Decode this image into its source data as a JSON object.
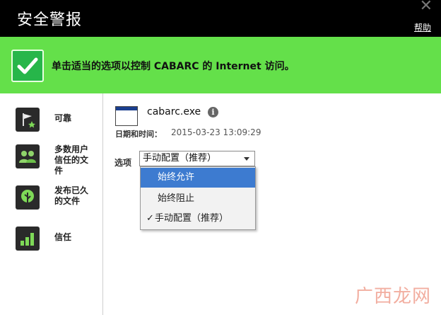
{
  "window": {
    "title": "安全警报",
    "help_label": "帮助",
    "close_glyph": "✕"
  },
  "banner": {
    "message": "单击适当的选项以控制 CABARC 的 Internet 访问。",
    "accent": "#64e04a"
  },
  "sidebar": {
    "items": [
      {
        "label": "可靠",
        "icon": "flag-star-icon"
      },
      {
        "label": "多数用户信任的文件",
        "icon": "users-icon"
      },
      {
        "label": "发布已久的文件",
        "icon": "tree-icon"
      },
      {
        "label": "信任",
        "icon": "signal-bars-icon"
      }
    ]
  },
  "file": {
    "name": "cabarc.exe",
    "info_glyph": "i",
    "datetime_label": "日期和时间：",
    "datetime_value": "2015-03-23 13:09:29"
  },
  "options": {
    "label": "选项",
    "selected": "手动配置（推荐）",
    "dropdown_items": [
      {
        "label": "始终允许",
        "highlighted": true,
        "checked": false
      },
      {
        "label": "始终阻止",
        "highlighted": false,
        "checked": false
      },
      {
        "label": "手动配置（推荐）",
        "highlighted": false,
        "checked": true
      }
    ],
    "check_glyph": "✓"
  },
  "watermark": "广西龙网"
}
